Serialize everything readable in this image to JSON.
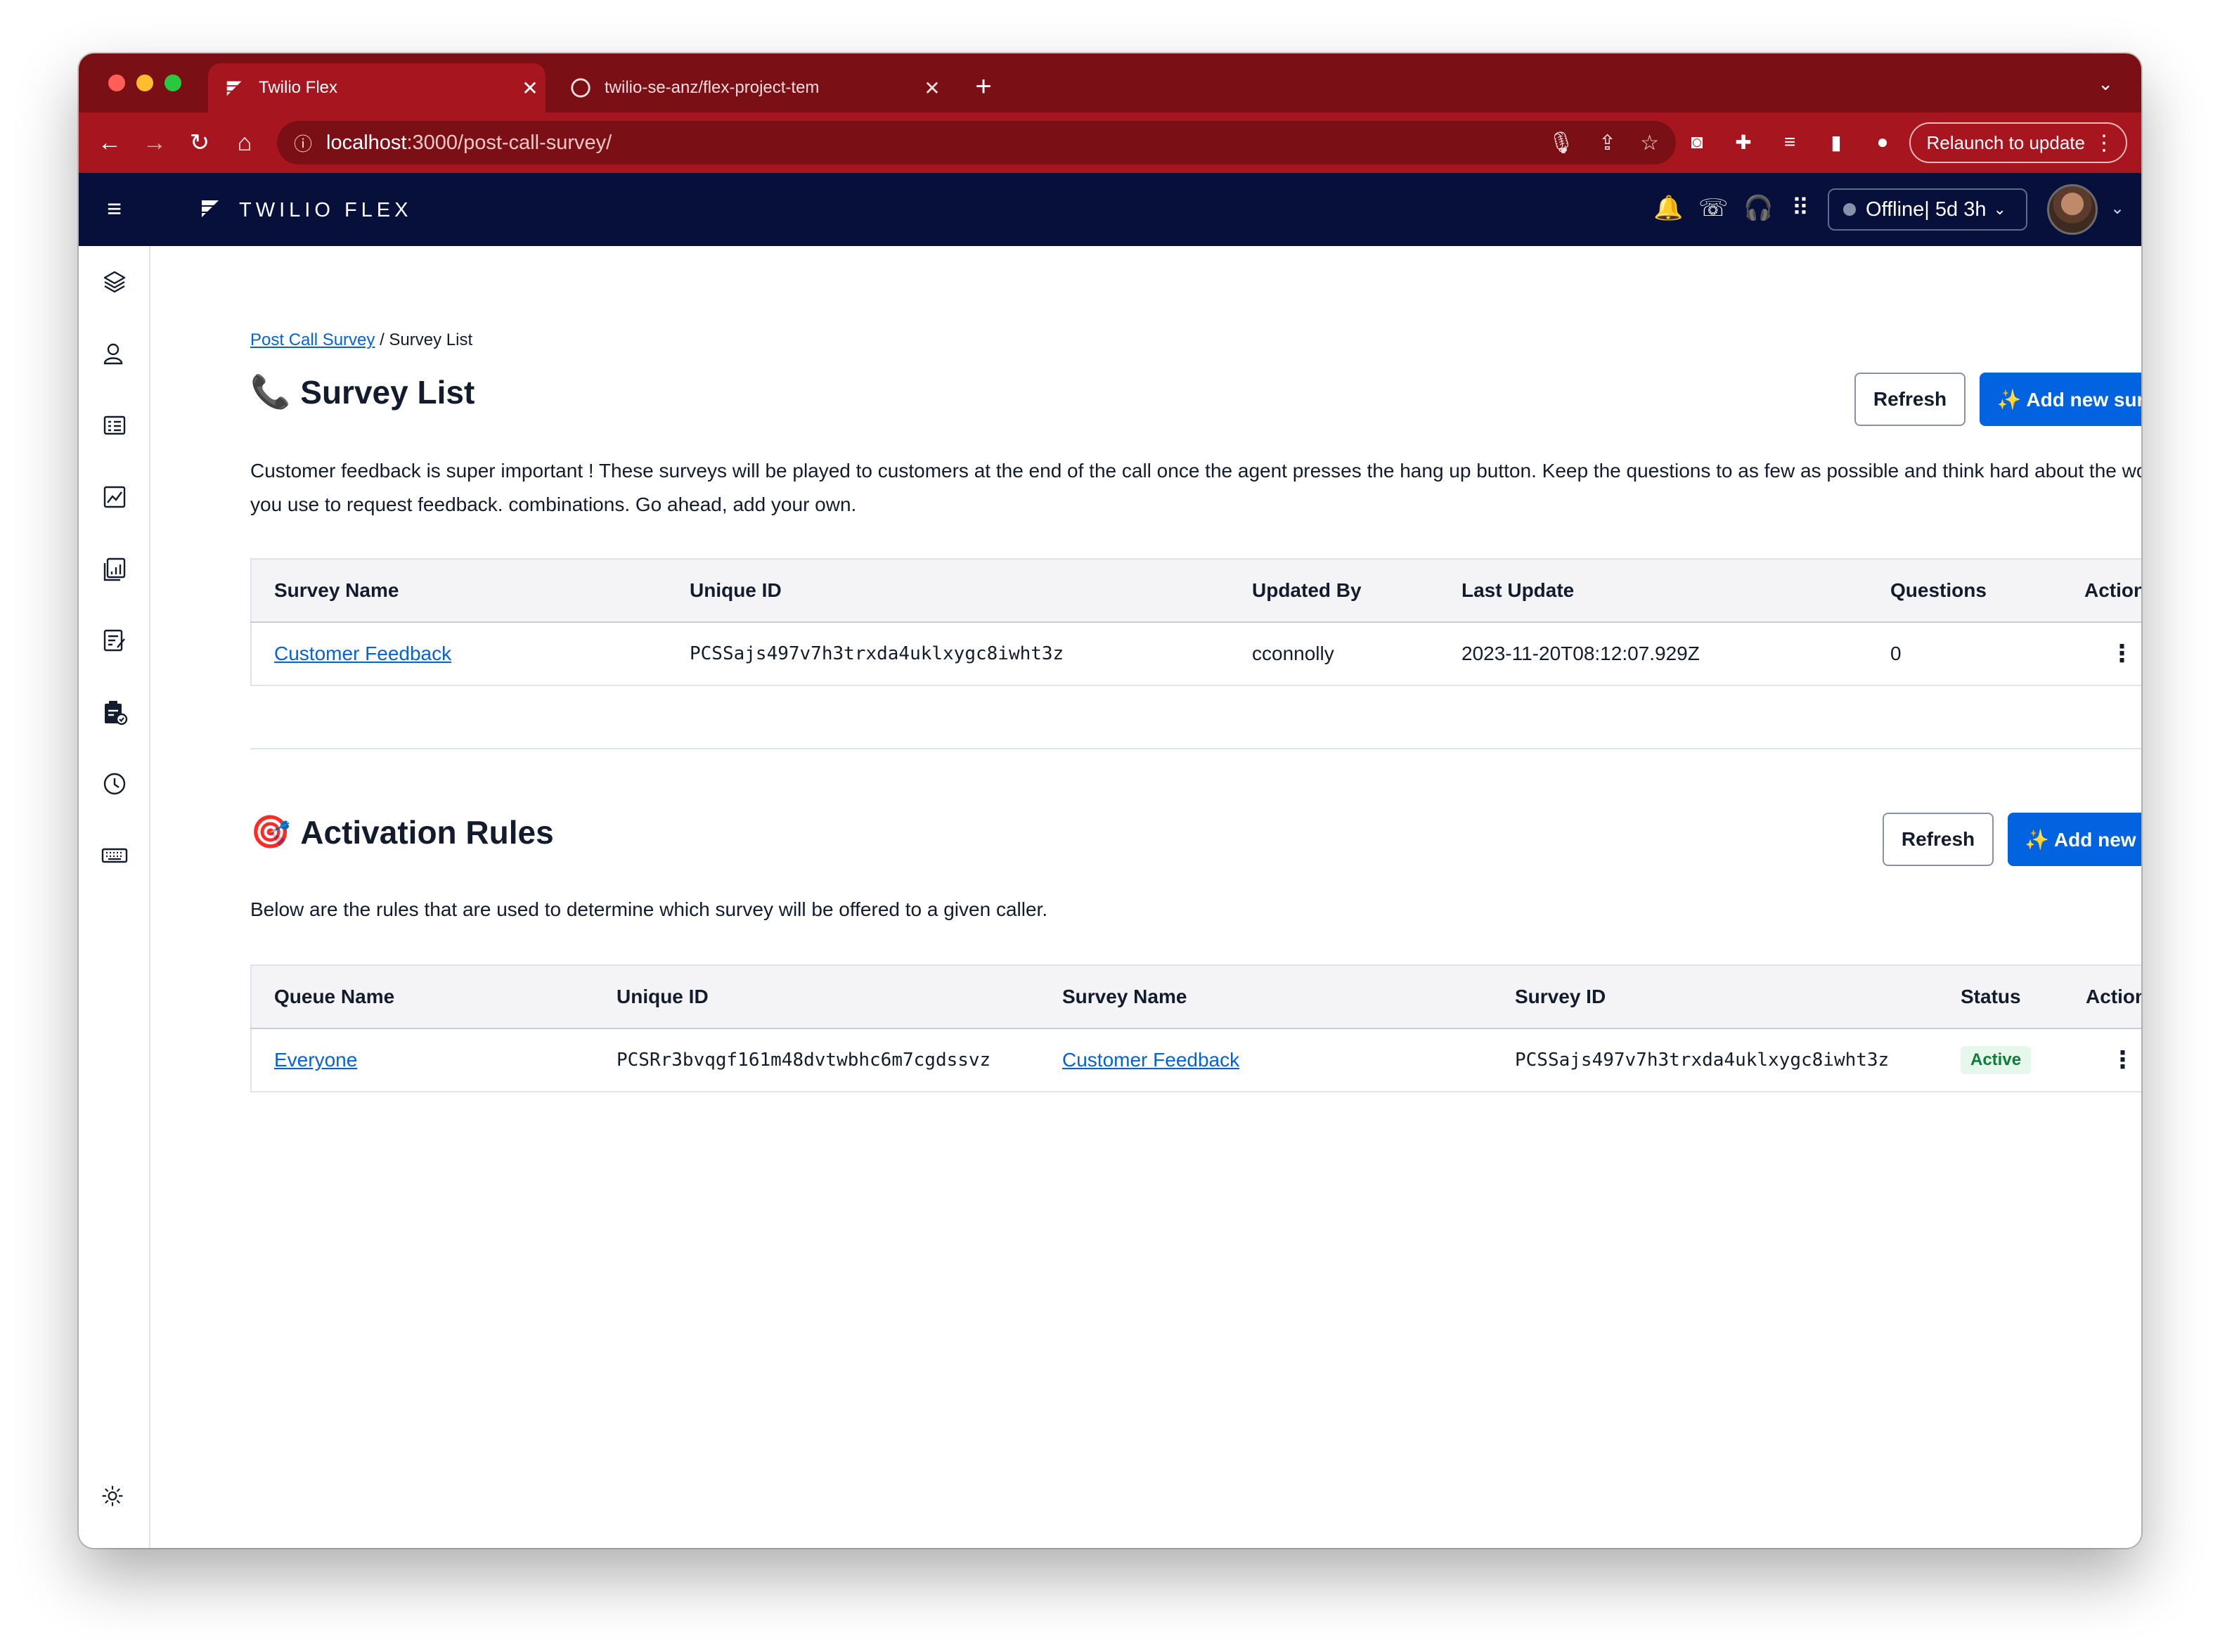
{
  "browser": {
    "tabs": [
      {
        "title": "Twilio Flex",
        "active": true
      },
      {
        "title": "twilio-se-anz/flex-project-tem",
        "active": false
      }
    ],
    "url_host": "localhost",
    "url_path": ":3000/post-call-survey/",
    "relaunch_label": "Relaunch to update"
  },
  "header": {
    "brand": "TWILIO FLEX",
    "status": "Offline| 5d 3h"
  },
  "breadcrumb": {
    "link": "Post Call Survey",
    "separator": "/",
    "current": "Survey List"
  },
  "survey_section": {
    "icon": "📞",
    "title": "Survey List",
    "refresh_label": "Refresh",
    "add_label": "✨ Add new survey",
    "description": "Customer feedback is super important ! These surveys will be played to customers at the end of the call once the agent presses the hang up button. Keep the questions to as few as possible and think hard about the words you use to request feedback. combinations. Go ahead, add your own.",
    "columns": [
      "Survey Name",
      "Unique ID",
      "Updated By",
      "Last Update",
      "Questions",
      "Actions"
    ],
    "rows": [
      {
        "name": "Customer Feedback",
        "unique_id": "PCSSajs497v7h3trxda4uklxygc8iwht3z",
        "updated_by": "cconnolly",
        "last_update": "2023-11-20T08:12:07.929Z",
        "questions": "0",
        "actions": "⋮"
      }
    ]
  },
  "rules_section": {
    "icon": "🎯",
    "title": "Activation Rules",
    "refresh_label": "Refresh",
    "add_label": "✨ Add new rule",
    "description": "Below are the rules that are used to determine which survey will be offered to a given caller.",
    "columns": [
      "Queue Name",
      "Unique ID",
      "Survey Name",
      "Survey ID",
      "Status",
      "Actions"
    ],
    "rows": [
      {
        "queue_name": "Everyone",
        "unique_id": "PCSRr3bvqgf161m48dvtwbhc6m7cgdssvz",
        "survey_name": "Customer Feedback",
        "survey_id": "PCSSajs497v7h3trxda4uklxygc8iwht3z",
        "status": "Active",
        "actions": "⋮"
      }
    ]
  },
  "colors": {
    "browser_frame": "#a7161f",
    "flex_header": "#06103a",
    "primary": "#0263e0",
    "active_badge": "#0e7c3a"
  }
}
